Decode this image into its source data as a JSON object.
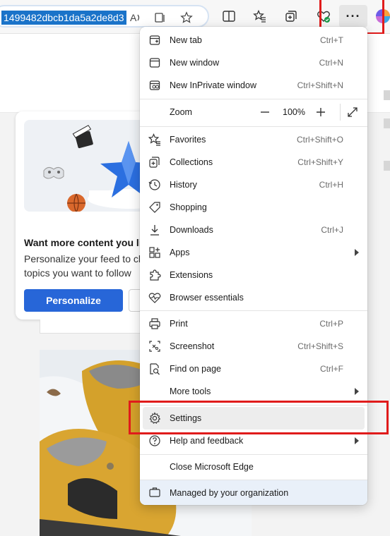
{
  "browser": {
    "address_text": "1499482dbcb1da5a2de8d3",
    "more_icon": "more-horizontal-icon",
    "more_label": "···"
  },
  "background_page": {
    "card_heading": "Want more content you li",
    "card_sub_line1": "Personalize your feed to ch",
    "card_sub_line2": "topics you want to follow",
    "personalize_label": "Personalize"
  },
  "menu": {
    "new_tab": {
      "label": "New tab",
      "shortcut": "Ctrl+T",
      "icon": "new-tab-icon"
    },
    "new_window": {
      "label": "New window",
      "shortcut": "Ctrl+N",
      "icon": "new-window-icon"
    },
    "new_inprivate": {
      "label": "New InPrivate window",
      "shortcut": "Ctrl+Shift+N",
      "icon": "inprivate-icon"
    },
    "zoom": {
      "label": "Zoom",
      "value": "100%",
      "minus": "−",
      "plus": "+"
    },
    "favorites": {
      "label": "Favorites",
      "shortcut": "Ctrl+Shift+O",
      "icon": "favorites-icon"
    },
    "collections": {
      "label": "Collections",
      "shortcut": "Ctrl+Shift+Y",
      "icon": "collections-icon"
    },
    "history": {
      "label": "History",
      "shortcut": "Ctrl+H",
      "icon": "history-icon"
    },
    "shopping": {
      "label": "Shopping",
      "icon": "shopping-tag-icon"
    },
    "downloads": {
      "label": "Downloads",
      "shortcut": "Ctrl+J",
      "icon": "download-icon"
    },
    "apps": {
      "label": "Apps",
      "icon": "apps-icon"
    },
    "extensions": {
      "label": "Extensions",
      "icon": "extensions-icon"
    },
    "browser_essentials": {
      "label": "Browser essentials",
      "icon": "heart-pulse-icon"
    },
    "print": {
      "label": "Print",
      "shortcut": "Ctrl+P",
      "icon": "print-icon"
    },
    "screenshot": {
      "label": "Screenshot",
      "shortcut": "Ctrl+Shift+S",
      "icon": "screenshot-icon"
    },
    "find_on_page": {
      "label": "Find on page",
      "shortcut": "Ctrl+F",
      "icon": "find-icon"
    },
    "more_tools": {
      "label": "More tools"
    },
    "settings": {
      "label": "Settings",
      "icon": "gear-icon"
    },
    "help": {
      "label": "Help and feedback",
      "icon": "help-icon"
    },
    "close_edge": {
      "label": "Close Microsoft Edge"
    },
    "managed": {
      "label": "Managed by your organization",
      "icon": "briefcase-icon"
    }
  },
  "colors": {
    "highlight_red": "#e01b1b",
    "accent_blue": "#2766d8",
    "managed_bg": "#e9f0f9"
  }
}
